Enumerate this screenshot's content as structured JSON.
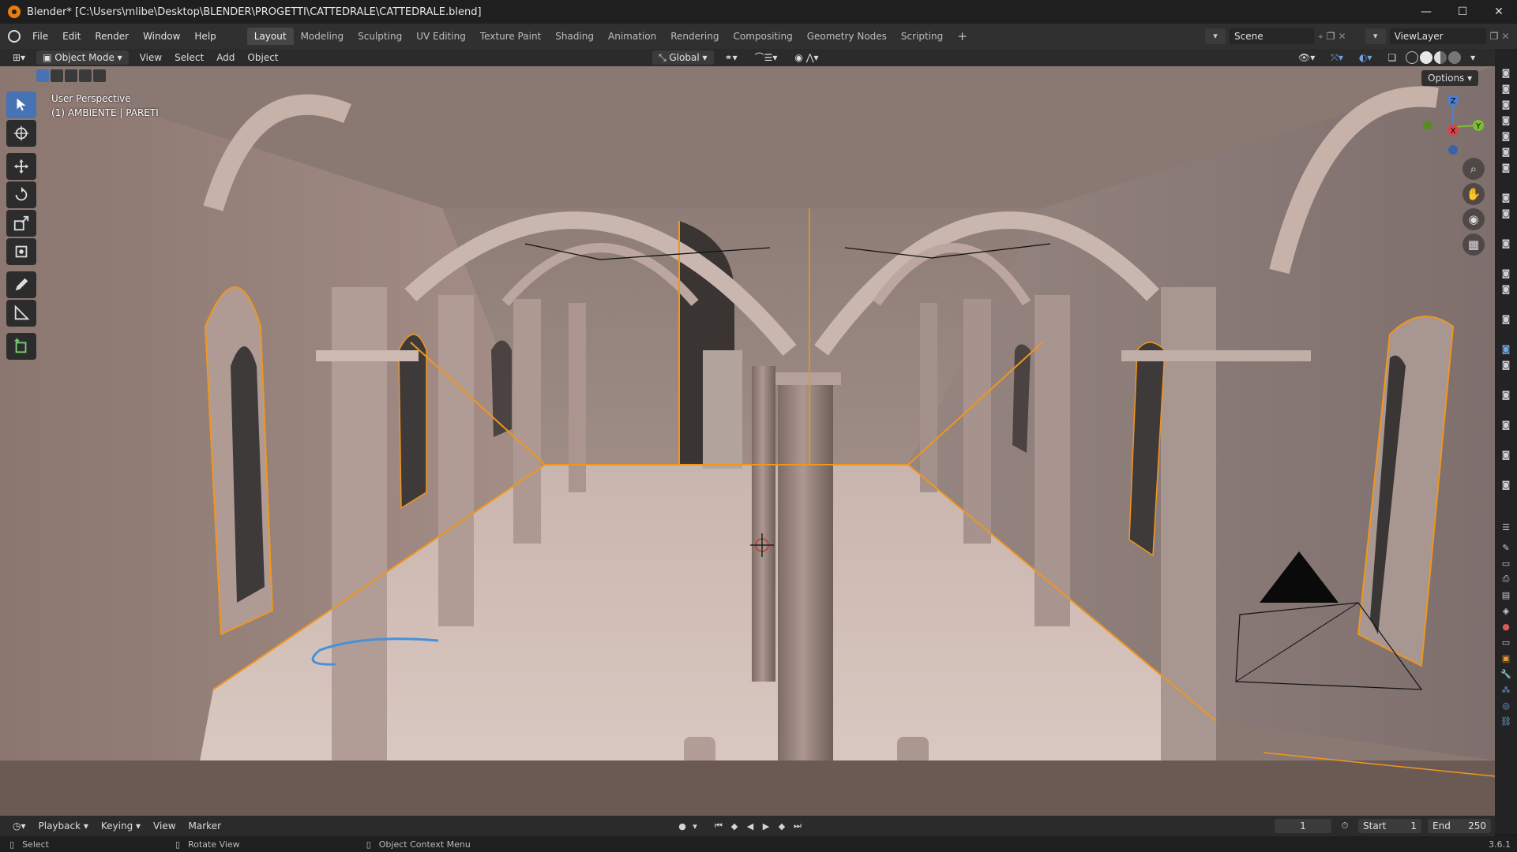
{
  "window": {
    "title": "Blender* [C:\\Users\\mlibe\\Desktop\\BLENDER\\PROGETTI\\CATTEDRALE\\CATTEDRALE.blend]",
    "controls": [
      "—",
      "☐",
      "✕"
    ]
  },
  "menu": {
    "items": [
      "File",
      "Edit",
      "Render",
      "Window",
      "Help"
    ],
    "workspaces": [
      "Layout",
      "Modeling",
      "Sculpting",
      "UV Editing",
      "Texture Paint",
      "Shading",
      "Animation",
      "Rendering",
      "Compositing",
      "Geometry Nodes",
      "Scripting"
    ],
    "active_workspace": "Layout",
    "add_tab": "+",
    "scene": "Scene",
    "view_layer": "ViewLayer"
  },
  "header": {
    "mode": "Object Mode",
    "menus": [
      "View",
      "Select",
      "Add",
      "Object"
    ],
    "orientation": "Global"
  },
  "viewport": {
    "perspective": "User Perspective",
    "collection": "(1) AMBIENTE | PARETI",
    "options": "Options",
    "gizmo": {
      "z": "Z",
      "x": "X",
      "y": "Y"
    }
  },
  "timeline": {
    "menus": [
      "Playback",
      "Keying",
      "View",
      "Marker"
    ],
    "current_frame": "1",
    "start_label": "Start",
    "start": "1",
    "end_label": "End",
    "end": "250"
  },
  "status": {
    "select": "Select",
    "rotate": "Rotate View",
    "context": "Object Context Menu",
    "version": "3.6.1"
  },
  "colors": {
    "accent": "#4772b3",
    "selection": "#f0961e",
    "wall": "#a8918a",
    "floor": "#c9b6ae"
  }
}
